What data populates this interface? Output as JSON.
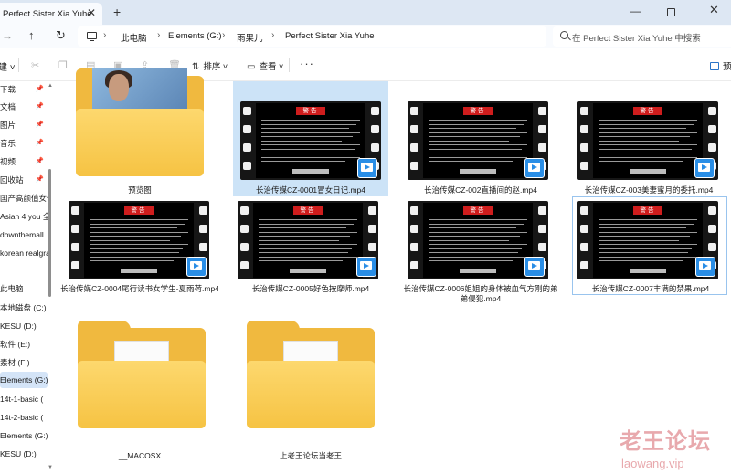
{
  "tab": {
    "title": "Perfect Sister Xia Yuhe"
  },
  "address": {
    "crumbs": [
      "此电脑",
      "Elements (G:)",
      "雨果儿",
      "Perfect Sister Xia Yuhe"
    ],
    "search_placeholder": "在 Perfect Sister Xia Yuhe 中搜索"
  },
  "toolbar": {
    "new_label": "建",
    "sort_label": "排序",
    "view_label": "查看",
    "more_label": "···",
    "preview_label": "预"
  },
  "sidebar": {
    "items": [
      {
        "label": "下载",
        "pinned": true
      },
      {
        "label": "文档",
        "pinned": true
      },
      {
        "label": "图片",
        "pinned": true
      },
      {
        "label": "音乐",
        "pinned": true
      },
      {
        "label": "视频",
        "pinned": true
      },
      {
        "label": "回收站",
        "pinned": true
      },
      {
        "label": "国产高颜值女优",
        "pinned": false
      },
      {
        "label": "Asian 4 you 全",
        "pinned": false
      },
      {
        "label": "downthemall",
        "pinned": false
      },
      {
        "label": "korean realgra",
        "pinned": false
      },
      {
        "label": "此电脑",
        "pinned": false
      },
      {
        "label": "本地磁盘 (C:)",
        "pinned": false
      },
      {
        "label": "KESU (D:)",
        "pinned": false
      },
      {
        "label": "软件 (E:)",
        "pinned": false
      },
      {
        "label": "素材 (F:)",
        "pinned": false
      },
      {
        "label": "Elements (G:)",
        "pinned": false,
        "selected": true
      },
      {
        "label": "14t-1-basic (",
        "pinned": false
      },
      {
        "label": "14t-2-basic (",
        "pinned": false
      },
      {
        "label": "Elements (G:)",
        "pinned": false
      },
      {
        "label": "KESU (D:)",
        "pinned": false
      }
    ]
  },
  "files": [
    {
      "name": "预览图",
      "kind": "image-folder"
    },
    {
      "name": "长治传媒CZ-0001冒女日记.mp4",
      "kind": "video",
      "selected": true
    },
    {
      "name": "长治传媒CZ-002直播间的赵.mp4",
      "kind": "video"
    },
    {
      "name": "长治传媒CZ-003美妻蜜月的委托.mp4",
      "kind": "video"
    },
    {
      "name": "长治传媒CZ-0004尾行读书女学生-夏雨荷.mp4",
      "kind": "video"
    },
    {
      "name": "长治传媒CZ-0005好色按摩师.mp4",
      "kind": "video"
    },
    {
      "name": "长治传媒CZ-0006姐姐的身体被血气方刚的弟弟侵犯.mp4",
      "kind": "video"
    },
    {
      "name": "长治传媒CZ-0007丰满的禁果.mp4",
      "kind": "video",
      "outlined": true
    },
    {
      "name": "__MACOSX",
      "kind": "folder"
    },
    {
      "name": "上老王论坛当老王",
      "kind": "folder"
    }
  ],
  "thumbnail": {
    "warning_text": "警告"
  },
  "watermark": {
    "cn": "老王论坛",
    "en": "laowang.vip"
  },
  "colors": {
    "accent": "#2a8ee6",
    "folder": "#f6c343",
    "selection": "#cce3f7",
    "warning_red": "#cf1d1d"
  }
}
